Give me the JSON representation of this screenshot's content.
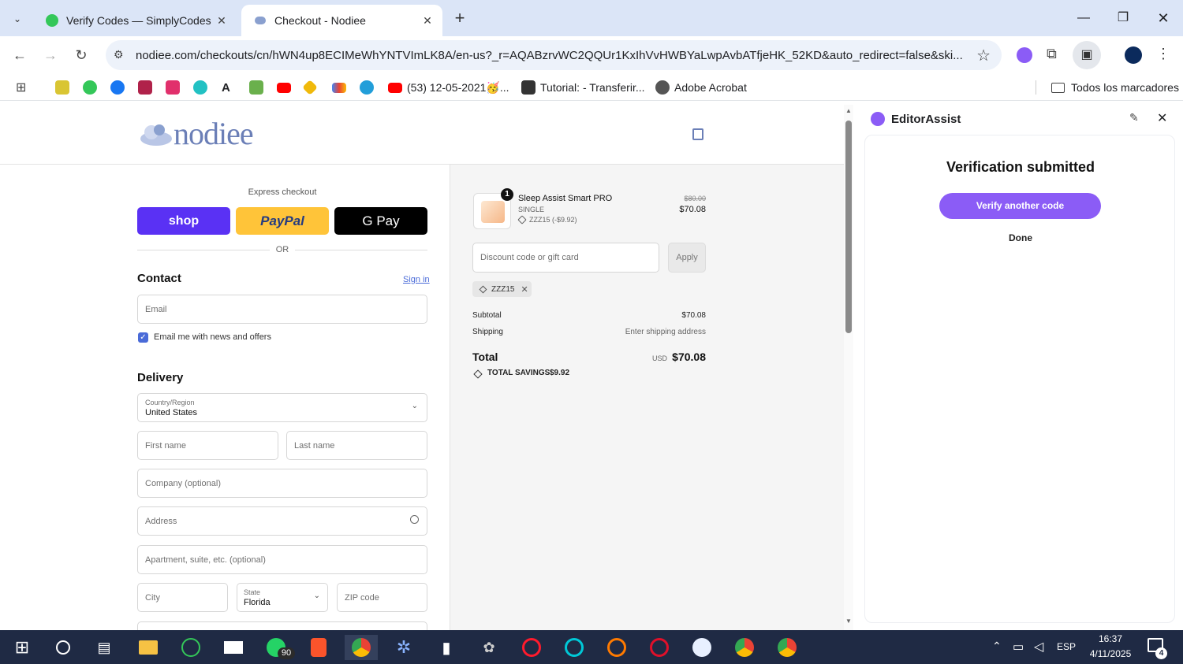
{
  "browser": {
    "tabs": [
      {
        "title": "Verify Codes — SimplyCodes",
        "active": false
      },
      {
        "title": "Checkout - Nodiee",
        "active": true
      }
    ],
    "url": "nodiee.com/checkouts/cn/hWN4up8ECIMeWhYNTVImLK8A/en-us?_r=AQABzrvWC2QQUr1KxIhVvHWBYaLwpAvbATfjeHK_52KD&auto_redirect=false&ski...",
    "bookmarks": [
      {
        "label": "",
        "icon": "bookmark-icon-1"
      },
      {
        "label": "",
        "icon": "bookmark-icon-2"
      },
      {
        "label": "",
        "icon": "facebook-icon"
      },
      {
        "label": "",
        "icon": "bookmark-icon-4"
      },
      {
        "label": "",
        "icon": "instagram-icon"
      },
      {
        "label": "",
        "icon": "bookmark-icon-6"
      },
      {
        "label": "",
        "icon": "bookmark-icon-7"
      },
      {
        "label": "",
        "icon": "bookmark-icon-8"
      },
      {
        "label": "",
        "icon": "youtube-icon"
      },
      {
        "label": "",
        "icon": "bookmark-icon-10"
      },
      {
        "label": "",
        "icon": "gmail-icon"
      },
      {
        "label": "",
        "icon": "telegram-icon"
      },
      {
        "label": "(53) 12-05-2021🥳...",
        "icon": "youtube-icon"
      },
      {
        "label": "Tutorial: - Transferir...",
        "icon": "fb-icon"
      },
      {
        "label": "Adobe Acrobat",
        "icon": "globe-icon"
      }
    ],
    "all_bookmarks": "Todos los marcadores"
  },
  "checkout": {
    "logo": "nodiee",
    "express_title": "Express checkout",
    "shop_label": "shop",
    "paypal_label": "PayPal",
    "gpay_label": "G Pay",
    "or_label": "OR",
    "contact_title": "Contact",
    "signin_label": "Sign in",
    "email_placeholder": "Email",
    "news_label": "Email me with news and offers",
    "delivery_title": "Delivery",
    "country_label": "Country/Region",
    "country_value": "United States",
    "first_name": "First name",
    "last_name": "Last name",
    "company": "Company (optional)",
    "address": "Address",
    "apartment": "Apartment, suite, etc. (optional)",
    "city": "City",
    "state_label": "State",
    "state_value": "Florida",
    "zip": "ZIP code"
  },
  "summary": {
    "qty": "1",
    "product_name": "Sleep Assist Smart PRO",
    "variant": "SINGLE",
    "discount_line": "ZZZ15 (-$9.92)",
    "old_price": "$80.00",
    "price": "$70.08",
    "discount_placeholder": "Discount code or gift card",
    "apply_label": "Apply",
    "code_tag": "ZZZ15",
    "subtotal_label": "Subtotal",
    "subtotal_value": "$70.08",
    "shipping_label": "Shipping",
    "shipping_value": "Enter shipping address",
    "total_label": "Total",
    "currency": "USD",
    "total_value": "$70.08",
    "savings_label": "TOTAL SAVINGS",
    "savings_value": "$9.92"
  },
  "side_panel": {
    "title": "EditorAssist",
    "heading": "Verification submitted",
    "verify_btn": "Verify another code",
    "done_btn": "Done"
  },
  "taskbar": {
    "whatsapp_badge": "90",
    "lang": "ESP",
    "time": "16:37",
    "date": "4/11/2025",
    "notif_count": "4"
  },
  "colors": {
    "shop": "#5a31f4",
    "paypal": "#ffc439",
    "accent": "#8b5cf6",
    "tabstrip": "#dbe5f7"
  }
}
